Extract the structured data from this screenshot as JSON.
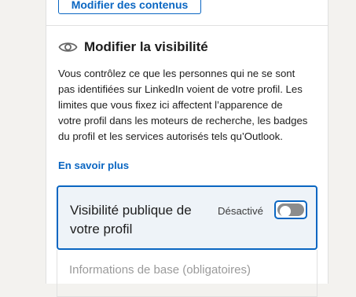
{
  "top": {
    "edit_content_button": "Modifier des contenus"
  },
  "visibility_section": {
    "icon": "eye-icon",
    "title": "Modifier la visibilité",
    "description": "Vous contrôlez ce que les personnes qui ne se sont pas identifiées sur LinkedIn voient de votre profil. Les limites que vous fixez ici affectent l’apparence de votre profil dans les moteurs de recherche, les badges du profil et les services autorisés tels qu’Outlook.",
    "learn_more": "En savoir plus"
  },
  "public_visibility_card": {
    "title": "Visibilité publique de votre profil",
    "toggle_label": "Désactivé",
    "toggle_on": false
  },
  "basic_info": {
    "label": "Informations de base (obligatoires)"
  },
  "colors": {
    "accent": "#0a66c2",
    "card_background": "#eef3f8",
    "toggle_off": "#8c8c8c"
  }
}
